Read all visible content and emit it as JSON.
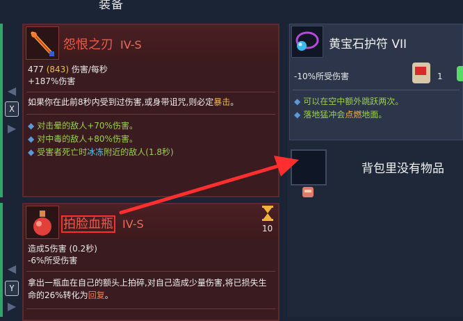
{
  "screen": {
    "title": "装备"
  },
  "nav": {
    "weapon_key": "X",
    "potion_key": "Y"
  },
  "weapon": {
    "name": "怨恨之刃",
    "grade": "IV-S",
    "icon": "blade-icon",
    "dps": "477",
    "dps_bonus": "(843)",
    "dps_unit": "伤害/每秒",
    "damage_bonus": "+187%伤害",
    "description": {
      "before": "如果你在此前8秒内受到过伤害,或身带诅咒,则必定",
      "keyword": "暴击",
      "after": "。"
    },
    "bullets": [
      {
        "text": "对击晕的敌人+70%伤害。"
      },
      {
        "text": "对中毒的敌人+80%伤害。"
      },
      {
        "before": "受害者死亡时",
        "keyword": "冰冻",
        "after": "附近的敌人(1.8秒)"
      }
    ]
  },
  "potion": {
    "name": "拍脸血瓶",
    "grade": "IV-S",
    "icon": "potion-icon",
    "cooldown_icon": "hourglass-icon",
    "cooldown_value": "10",
    "stat1": "造成5伤害 (0.2秒)",
    "stat2": "-6%所受伤害",
    "description": {
      "before": "拿出一瓶血在自己的额头上拍碎,对自己造成少量伤害,将已损失生命的26%转化为",
      "keyword": "回复",
      "after": "。"
    }
  },
  "amulet": {
    "name": "黄宝石护符 VII",
    "icon": "amulet-icon",
    "stat": "-10%所受伤害",
    "scroll_icon": "scroll-icon",
    "scroll_count": "1",
    "bullets": [
      {
        "text": "可以在空中额外跳跃两次。"
      },
      {
        "before": "落地猛冲会",
        "keyword": "点燃",
        "after": "地面。"
      }
    ]
  },
  "backpack": {
    "empty_text": "背包里没有物品"
  },
  "colors": {
    "weapon_name": "#ef5a48",
    "keyword_gold": "#e9c14a",
    "bullet_green": "#9ccf52",
    "ice_blue": "#66c6f0",
    "annotation_red": "#ff2f2f"
  }
}
